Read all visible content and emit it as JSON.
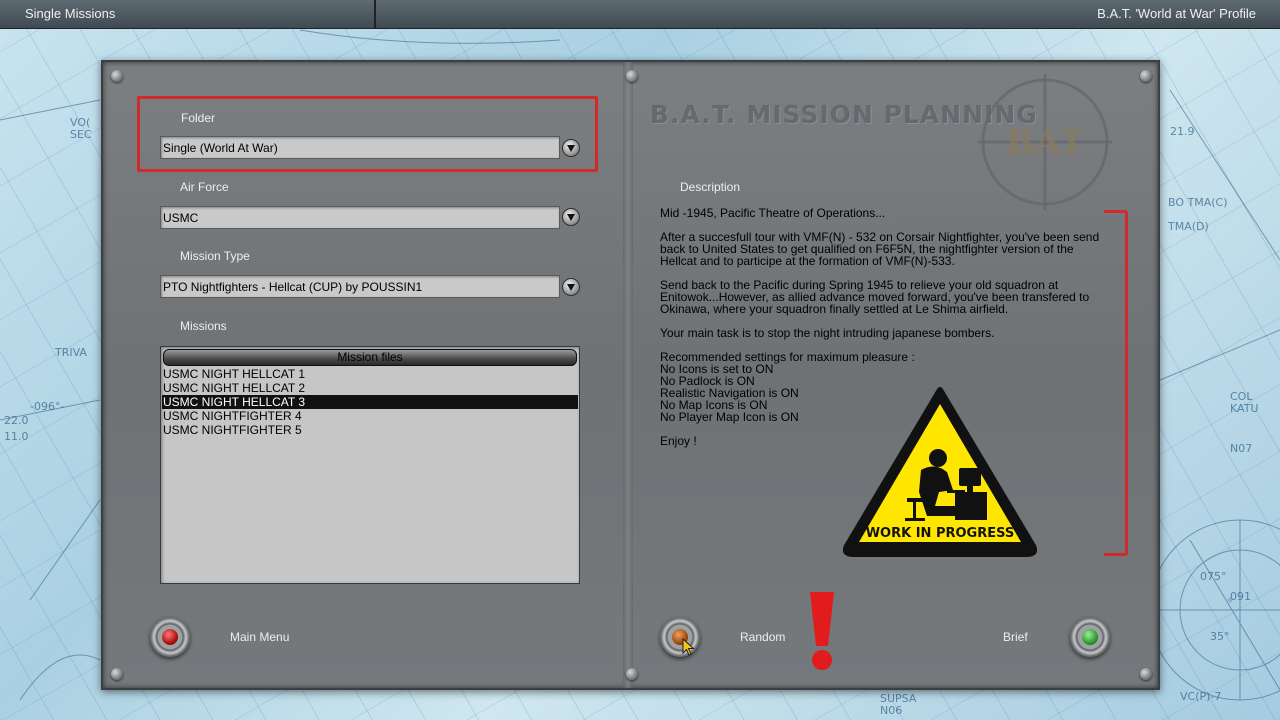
{
  "app": {
    "title": "Single Missions",
    "profile": "B.A.T. 'World at War' Profile"
  },
  "panel": {
    "planning_title": "B.A.T. MISSION PLANNING",
    "logo_text": "BAT"
  },
  "folder": {
    "label": "Folder",
    "value": "Single (World At War)"
  },
  "air_force": {
    "label": "Air Force",
    "value": "USMC"
  },
  "mission_type": {
    "label": "Mission Type",
    "value": "PTO Nightfighters - Hellcat (CUP) by POUSSIN1"
  },
  "missions": {
    "label": "Missions",
    "header": "Mission files",
    "items": [
      "USMC NIGHT HELLCAT 1",
      "USMC NIGHT HELLCAT 2",
      "USMC NIGHT HELLCAT 3",
      "USMC NIGHTFIGHTER 4",
      "USMC NIGHTFIGHTER 5"
    ],
    "selected_index": 2
  },
  "description": {
    "label": "Description",
    "p1": "Mid -1945, Pacific Theatre of Operations...",
    "p2": "After a succesfull tour with VMF(N) - 532 on Corsair Nightfighter, you've been send back to United States to get qualified on F6F5N, the nightfighter version of the Hellcat and to participe at the formation of VMF(N)-533.",
    "p3": "Send back to the Pacific during Spring 1945 to relieve your old squadron at Enitowok...However, as allied advance moved forward, you've been transfered to Okinawa, where your squadron finally settled at Le Shima airfield.",
    "p4": "Your main task is to stop the night intruding japanese bombers.",
    "p5_title": "Recommended settings for maximum pleasure :",
    "settings": [
      "No Icons is set to ON",
      "No Padlock is ON",
      "Realistic Navigation is ON",
      "No Map Icons is ON",
      "No Player Map Icon is ON"
    ],
    "p6": "Enjoy !"
  },
  "warning": {
    "text": "WORK IN PROGRESS"
  },
  "buttons": {
    "main_menu": "Main Menu",
    "random": "Random",
    "brief": "Brief"
  },
  "colors": {
    "highlight_red": "#d12a2a",
    "warning_yellow": "#ffe600",
    "main_menu_lamp": "#b01010",
    "random_lamp": "#a04a10",
    "brief_lamp": "#2f9a2f"
  },
  "icons": {
    "dropdown": "chevron-down-icon",
    "warning": "warning-sign-icon",
    "exclamation": "exclamation-icon",
    "cursor": "mouse-cursor-icon"
  }
}
